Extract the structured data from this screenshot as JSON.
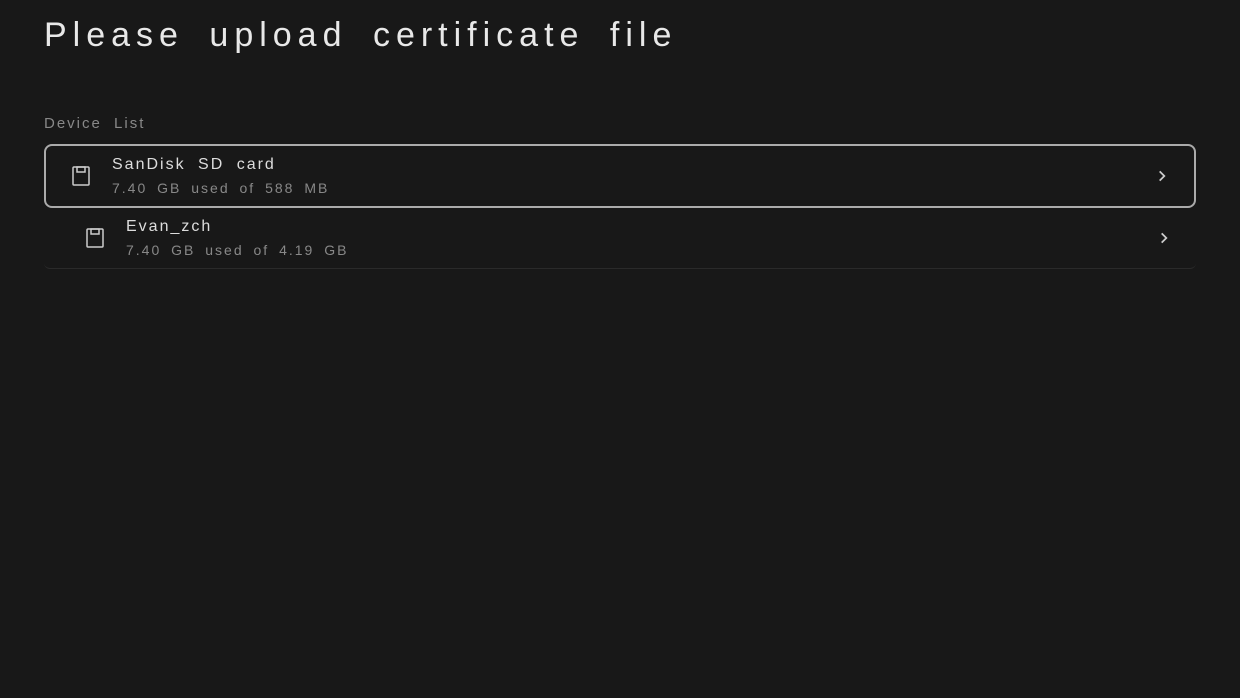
{
  "title": "Please upload certificate file",
  "sectionLabel": "Device List",
  "devices": [
    {
      "name": "SanDisk SD card",
      "usage": "7.40 GB used of 588 MB",
      "selected": true
    },
    {
      "name": "Evan_zch",
      "usage": "7.40 GB used of 4.19 GB",
      "selected": false
    }
  ]
}
